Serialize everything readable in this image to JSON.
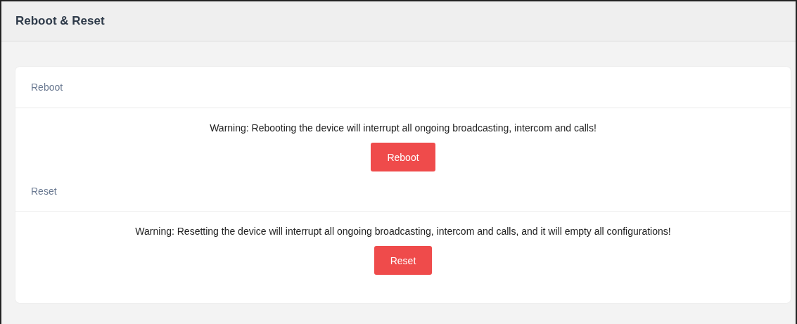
{
  "page": {
    "title": "Reboot & Reset"
  },
  "sections": [
    {
      "heading": "Reboot",
      "warning": "Warning: Rebooting the device will interrupt all ongoing broadcasting, intercom and calls!",
      "button": "Reboot"
    },
    {
      "heading": "Reset",
      "warning": "Warning: Resetting the device will interrupt all ongoing broadcasting, intercom and calls, and it will empty all configurations!",
      "button": "Reset"
    }
  ]
}
